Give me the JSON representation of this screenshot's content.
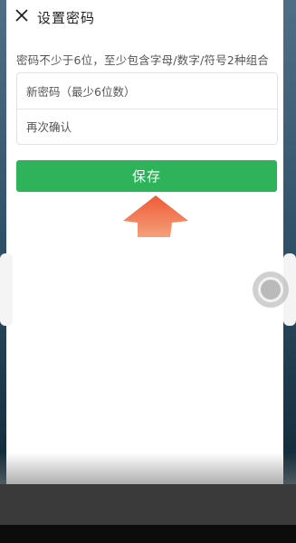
{
  "header": {
    "title": "设置密码",
    "close_icon": "close-icon"
  },
  "form": {
    "rule_text": "密码不少于6位，至少包含字母/数字/符号2种组合",
    "new_password": {
      "placeholder": "新密码（最少6位数）",
      "value": ""
    },
    "confirm_password": {
      "placeholder": "再次确认",
      "value": ""
    }
  },
  "actions": {
    "save_label": "保存",
    "save_color": "#2fb35a"
  },
  "overlay": {
    "arrow_color": "#e8623a",
    "floating_button_icon": "assistive-touch-icon"
  }
}
